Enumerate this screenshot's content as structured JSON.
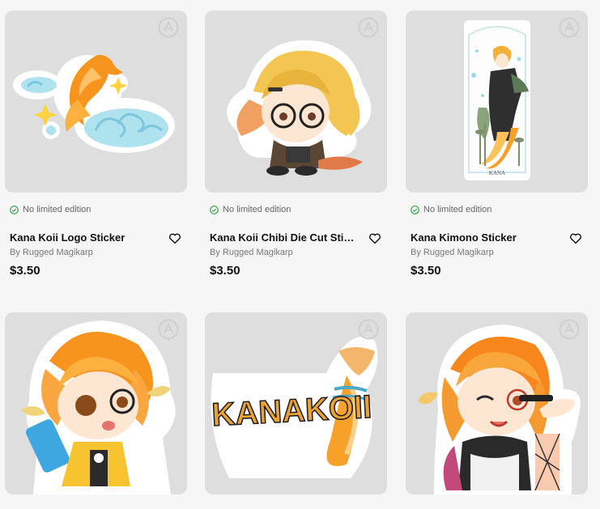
{
  "products": [
    {
      "title": "Kana Koii Logo Sticker",
      "edition": "No limited edition",
      "byline": "By Rugged Magikarp",
      "price": "$3.50",
      "icon": "kana-koii-logo-sticker-image"
    },
    {
      "title": "Kana Koii Chibi Die Cut Sticker",
      "edition": "No limited edition",
      "byline": "By Rugged Magikarp",
      "price": "$3.50",
      "icon": "chibi-sticker-image"
    },
    {
      "title": "Kana Kimono Sticker",
      "edition": "No limited edition",
      "byline": "By Rugged Magikarp",
      "price": "$3.50",
      "icon": "kimono-sticker-image",
      "art_text": "KANA"
    },
    {
      "title": "",
      "edition": "",
      "byline": "",
      "price": "",
      "icon": "phone-chibi-sticker-image"
    },
    {
      "title": "",
      "edition": "",
      "byline": "",
      "price": "",
      "icon": "kanakoii-text-logo-sticker-image",
      "art_text": "KANAKOII"
    },
    {
      "title": "",
      "edition": "",
      "byline": "",
      "price": "",
      "icon": "wink-sticker-image"
    }
  ],
  "colors": {
    "card_bg": "#dedede",
    "accent_orange": "#f7941d",
    "cloud_blue": "#8fd3e6",
    "check_green": "#2e9e44"
  }
}
